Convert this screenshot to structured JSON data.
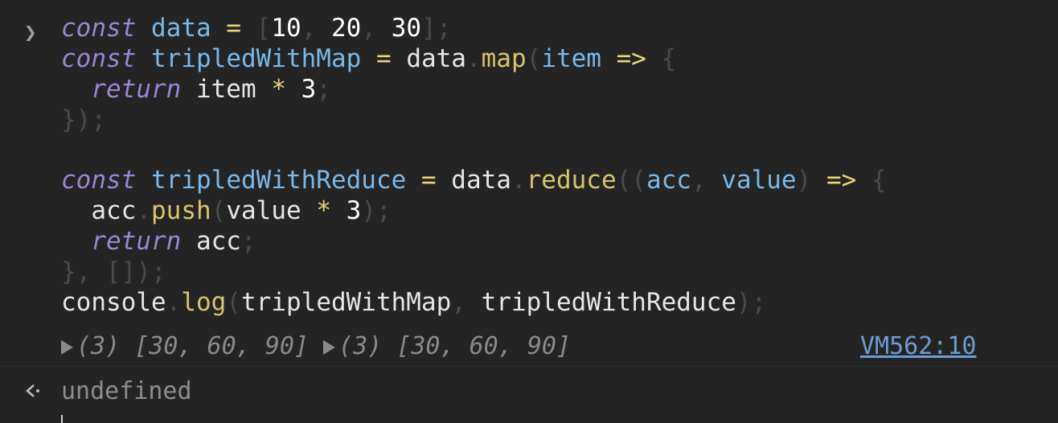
{
  "prompt_icon": "chevron-right-icon",
  "code": {
    "line1": {
      "kw": "const",
      "var": "data",
      "eq": "=",
      "lbr": "[",
      "n1": "10",
      "c1": ",",
      "n2": "20",
      "c2": ",",
      "n3": "30",
      "rbr": "]",
      "semi": ";"
    },
    "line2": {
      "kw": "const",
      "var": "tripledWithMap",
      "eq": "=",
      "obj": "data",
      "dot": ".",
      "fn": "map",
      "lp": "(",
      "param": "item",
      "arrow": "=>",
      "brace": "{"
    },
    "line3": {
      "kw": "return",
      "expr": "item",
      "op": "*",
      "num": "3",
      "semi": ";"
    },
    "line4": {
      "close": "});"
    },
    "line6": {
      "kw": "const",
      "var": "tripledWithReduce",
      "eq": "=",
      "obj": "data",
      "dot": ".",
      "fn": "reduce",
      "lp": "((",
      "p1": "acc",
      "comma": ",",
      "p2": "value",
      "rp": ")",
      "arrow": "=>",
      "brace": "{"
    },
    "line7": {
      "obj": "acc",
      "dot": ".",
      "fn": "push",
      "lp": "(",
      "arg": "value",
      "op": "*",
      "num": "3",
      "rp": ");"
    },
    "line8": {
      "kw": "return",
      "expr": "acc",
      "semi": ";"
    },
    "line9": {
      "close": "}, []);"
    },
    "line10": {
      "obj": "console",
      "dot": ".",
      "fn": "log",
      "lp": "(",
      "a1": "tripledWithMap",
      "comma": ",",
      "a2": "tripledWithReduce",
      "rp": ");"
    }
  },
  "output": {
    "arr1_icon": "expand-triangle-icon",
    "arr1": "(3) [30, 60, 90]",
    "arr2_icon": "expand-triangle-icon",
    "arr2": "(3) [30, 60, 90]",
    "source_link": "VM562:10"
  },
  "return_value": {
    "icon": "return-arrow-icon",
    "text": "undefined"
  },
  "colors": {
    "background": "#242424",
    "keyword": "#9a85d6",
    "variable": "#79b8e8",
    "operator": "#e8d47a",
    "function": "#d8c36d",
    "link": "#6e9bd1"
  }
}
